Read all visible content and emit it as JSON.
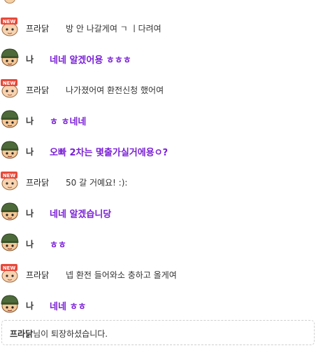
{
  "messages": [
    {
      "sender": "프라닭",
      "text": "방 안 나갈게여 ㄱ ㅣ다려여",
      "mine": false
    },
    {
      "sender": "나",
      "text": "네네 알겠어용 ㅎㅎㅎ",
      "mine": true
    },
    {
      "sender": "프라닭",
      "text": "나가졌어여 환전신청 했어여",
      "mine": false
    },
    {
      "sender": "나",
      "text": "ㅎ ㅎ네네",
      "mine": true
    },
    {
      "sender": "나",
      "text": "오빠 2차는 몇출가실거에용ㅇ?",
      "mine": true
    },
    {
      "sender": "프라닭",
      "text": "50 갈 거예요! :):",
      "mine": false
    },
    {
      "sender": "나",
      "text": "네네 알겠습니당",
      "mine": true
    },
    {
      "sender": "나",
      "text": "ㅎㅎ",
      "mine": true
    },
    {
      "sender": "프라닭",
      "text": "넵 환전 들어와소 충하고 올게여",
      "mine": false
    },
    {
      "sender": "나",
      "text": "네네 ㅎㅎ",
      "mine": true
    }
  ],
  "notice": {
    "name": "프라닭",
    "text": "님이 퇴장하셨습니다."
  },
  "badge": {
    "label": "NEW"
  },
  "colors": {
    "my_message": "#7a1fd6",
    "badge": "#e8493a",
    "helmet": "#4d6b3a"
  }
}
